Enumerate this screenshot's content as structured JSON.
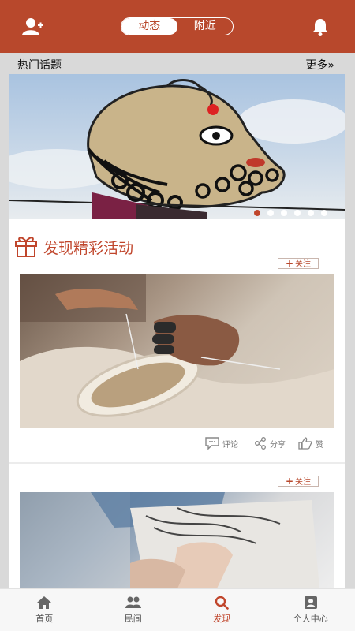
{
  "header": {
    "tabs": [
      {
        "label": "动态",
        "active": true
      },
      {
        "label": "附近",
        "active": false
      }
    ],
    "left_icon": "add-user-icon",
    "right_icon": "bell-icon"
  },
  "hot_topics": {
    "title": "热门话题",
    "more_label": "更多»"
  },
  "banner": {
    "subject": "shadow puppet against sky",
    "slide_count": 6,
    "active_slide": 1
  },
  "activities": {
    "title": "发现精彩活动",
    "icon": "gift-icon"
  },
  "posts": [
    {
      "follow_label": "关注",
      "photo_subject": "hands stitching a cloth shoe sole",
      "comment_label": "评论",
      "share_label": "分享",
      "like_label": "赞"
    },
    {
      "follow_label": "关注",
      "photo_subject": "potter's hands with clay"
    }
  ],
  "tabbar": {
    "items": [
      {
        "label": "首页",
        "icon": "home-icon",
        "active": false
      },
      {
        "label": "民间",
        "icon": "people-icon",
        "active": false
      },
      {
        "label": "发现",
        "icon": "search-icon",
        "active": true
      },
      {
        "label": "个人中心",
        "icon": "profile-icon",
        "active": false
      }
    ]
  },
  "colors": {
    "brand": "#b8482c",
    "accent": "#c0452b",
    "background": "#d9d9d9"
  }
}
